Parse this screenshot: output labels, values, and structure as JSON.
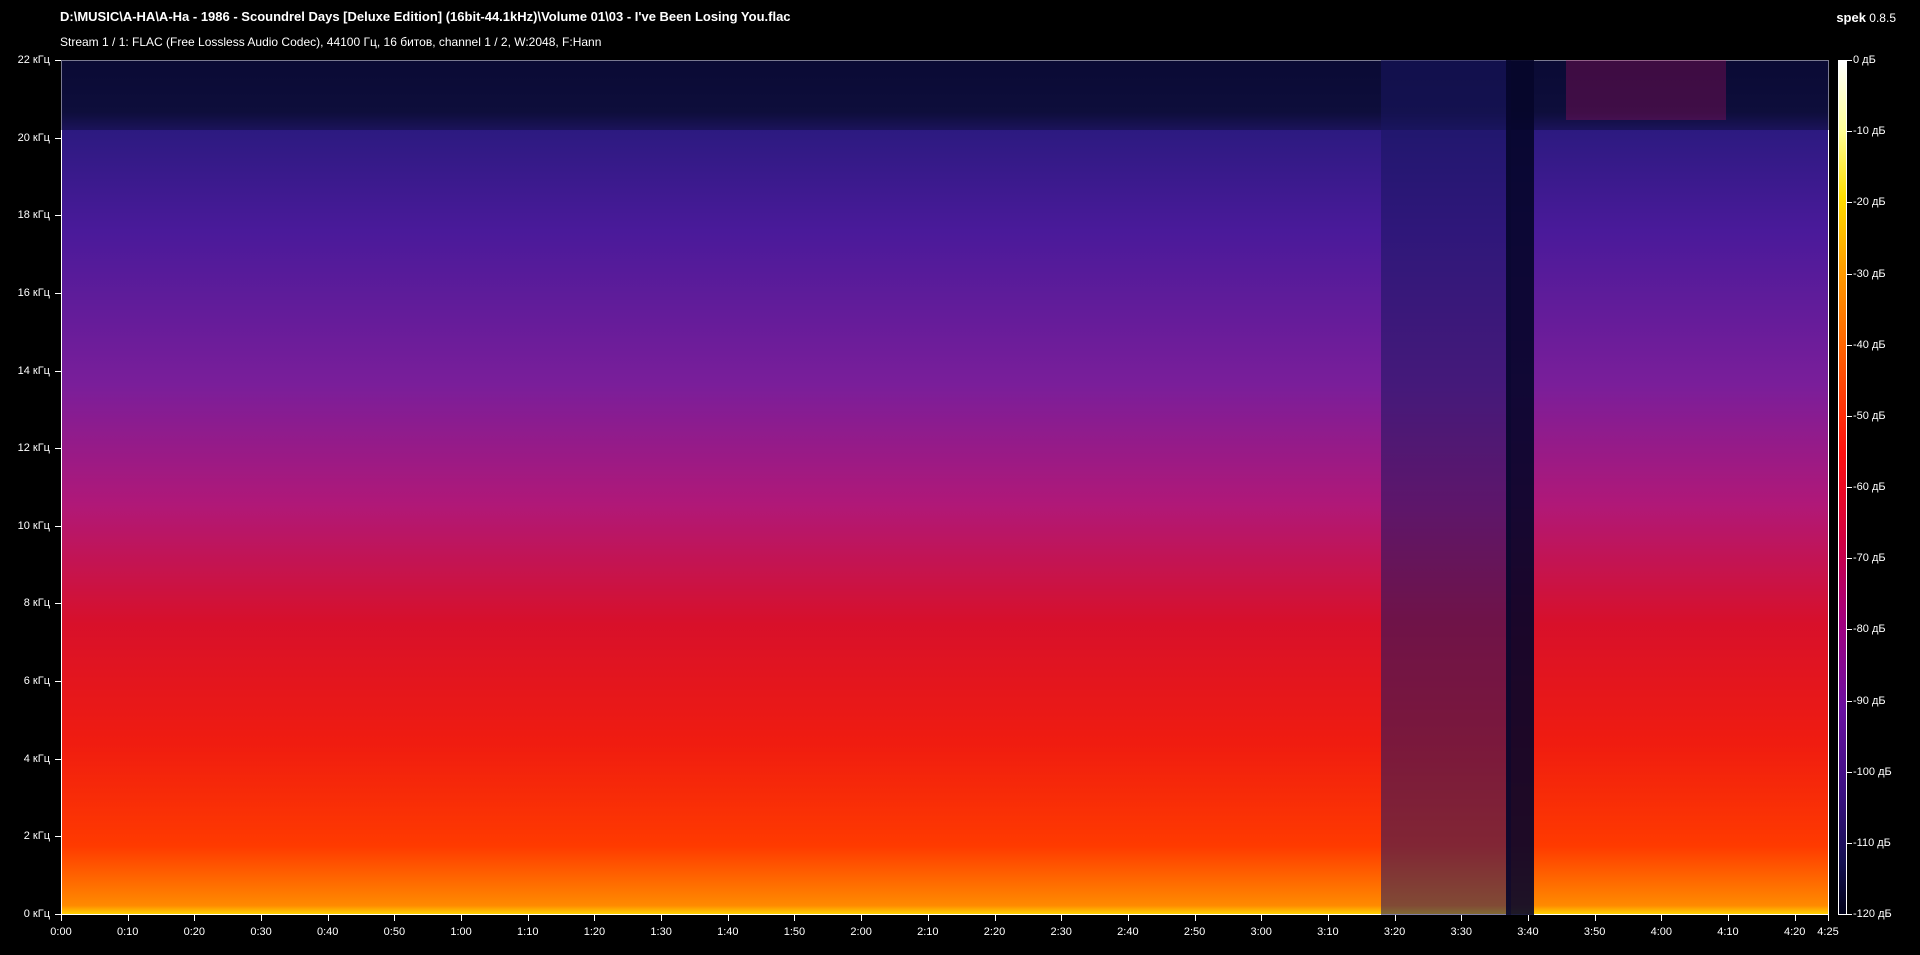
{
  "window": {
    "title": "D:\\MUSIC\\A-HA\\A-Ha - 1986 - Scoundrel Days [Deluxe Edition] (16bit-44.1kHz)\\Volume 01\\03 - I've Been Losing You.flac",
    "subtitle": "Stream 1 / 1: FLAC (Free Lossless Audio Codec), 44100 Гц, 16 битов, channel 1 / 2, W:2048, F:Hann",
    "app_name": "spek",
    "app_version": "0.8.5"
  },
  "spectrogram": {
    "y_ticks": [
      "22 кГц",
      "20 кГц",
      "18 кГц",
      "16 кГц",
      "14 кГц",
      "12 кГц",
      "10 кГц",
      "8 кГц",
      "6 кГц",
      "4 кГц",
      "2 кГц",
      "0 кГц"
    ],
    "x_ticks": [
      "0:00",
      "0:10",
      "0:20",
      "0:30",
      "0:40",
      "0:50",
      "1:00",
      "1:10",
      "1:20",
      "1:30",
      "1:40",
      "1:50",
      "2:00",
      "2:10",
      "2:20",
      "2:30",
      "2:40",
      "2:50",
      "3:00",
      "3:10",
      "3:20",
      "3:30",
      "3:40",
      "3:50",
      "4:00",
      "4:10",
      "4:20",
      "4:25"
    ],
    "colorbar_ticks": [
      "0 дБ",
      "-10 дБ",
      "-20 дБ",
      "-30 дБ",
      "-40 дБ",
      "-50 дБ",
      "-60 дБ",
      "-70 дБ",
      "-80 дБ",
      "-90 дБ",
      "-100 дБ",
      "-110 дБ",
      "-120 дБ"
    ],
    "colors": {
      "background": "#000000",
      "low": "#0a0a30",
      "mid": "#7a1e9a",
      "high": "#f01c10",
      "peak": "#ffd000"
    }
  }
}
